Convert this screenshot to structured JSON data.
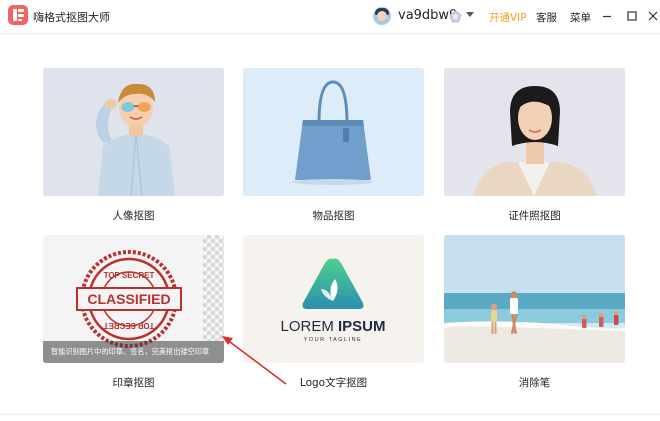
{
  "app": {
    "title": "嗨格式抠图大师",
    "brand_color": "#f06464"
  },
  "user": {
    "name": "va9dbw9"
  },
  "header": {
    "vip": "开通VIP",
    "support": "客服",
    "menu": "菜单"
  },
  "colors": {
    "vip": "#f0a020"
  },
  "cards": [
    {
      "label": "人像抠图"
    },
    {
      "label": "物品抠图"
    },
    {
      "label": "证件照抠图"
    },
    {
      "label": "印章抠图",
      "tooltip": "智能识别图片中的印章、签名，完美抠出镂空印章",
      "stamp_top": "TOP SECRET",
      "stamp_center": "CLASSIFIED",
      "stamp_bottom": "TOP SECRET"
    },
    {
      "label": "Logo文字抠图",
      "logo_main": "LOREM",
      "logo_bold": "IPSUM",
      "logo_tagline": "YOUR TAGLINE"
    },
    {
      "label": "消除笔"
    }
  ]
}
